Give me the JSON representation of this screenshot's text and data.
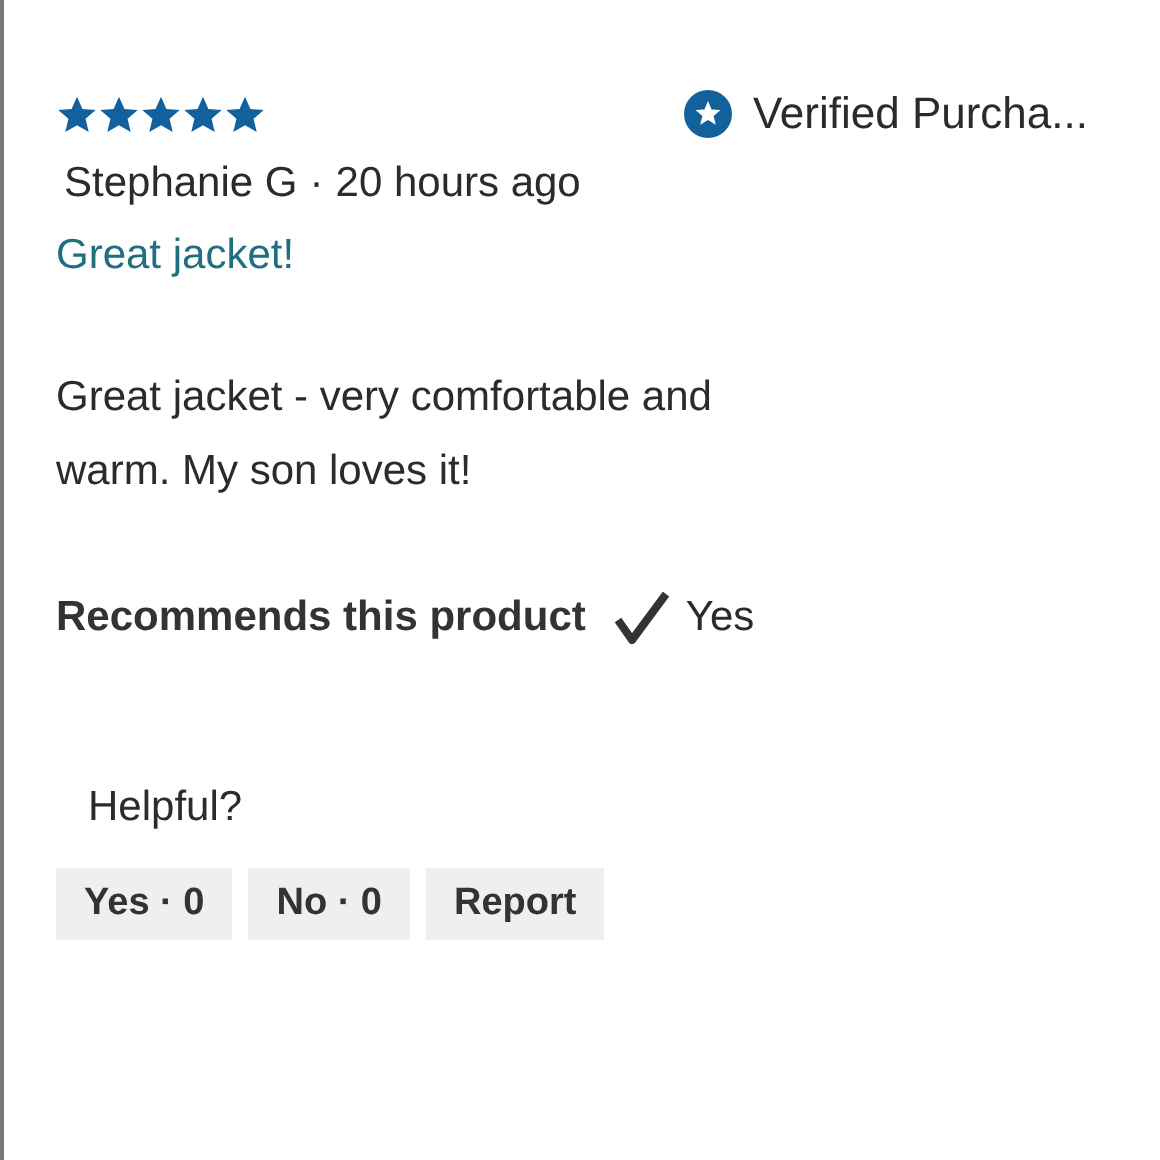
{
  "review": {
    "stars": 5,
    "verified": "Verified Purcha...",
    "author": "Stephanie G",
    "separator": "·",
    "time": "20 hours ago",
    "title": "Great jacket!",
    "body": "Great jacket - very comfortable and warm. My son loves it!",
    "recommend_label": "Recommends this product",
    "recommend_value": "Yes"
  },
  "helpful": {
    "label": "Helpful?",
    "buttons": [
      {
        "label": "Yes · 0"
      },
      {
        "label": "No · 0"
      },
      {
        "label": "Report"
      }
    ]
  }
}
